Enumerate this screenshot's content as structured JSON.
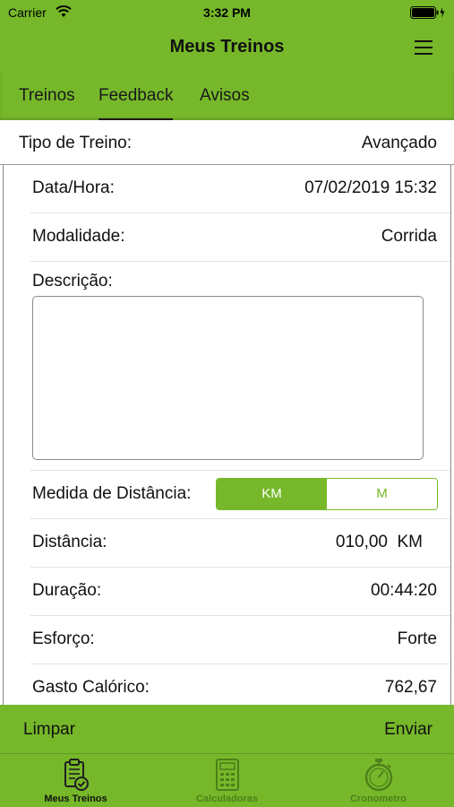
{
  "status_bar": {
    "carrier": "Carrier",
    "time": "3:32 PM",
    "wifi_icon": "wifi-icon",
    "battery_icon": "battery-icon"
  },
  "nav": {
    "title": "Meus Treinos",
    "menu_icon": "hamburger-menu-icon"
  },
  "tabs": [
    {
      "label": "Treinos",
      "active": false
    },
    {
      "label": "Feedback",
      "active": true
    },
    {
      "label": "Avisos",
      "active": false
    }
  ],
  "form": {
    "tipo_label": "Tipo de Treino:",
    "tipo_value": "Avançado",
    "data_label": "Data/Hora:",
    "data_value": "07/02/2019 15:32",
    "modalidade_label": "Modalidade:",
    "modalidade_value": "Corrida",
    "descricao_label": "Descrição:",
    "descricao_value": "",
    "medida_label": "Medida de Distância:",
    "medida_options": [
      "KM",
      "M"
    ],
    "medida_selected": "KM",
    "distancia_label": "Distância:",
    "distancia_value": "010,00",
    "distancia_unit": "KM",
    "duracao_label": "Duração:",
    "duracao_value": "00:44:20",
    "esforco_label": "Esforço:",
    "esforco_value": "Forte",
    "gasto_label": "Gasto Calórico:",
    "gasto_value": "762,67"
  },
  "actions": {
    "limpar": "Limpar",
    "enviar": "Enviar"
  },
  "tab_bar": [
    {
      "label": "Meus Treinos",
      "icon": "clipboard-check-icon",
      "active": true
    },
    {
      "label": "Calculadoras",
      "icon": "calculator-icon",
      "active": false
    },
    {
      "label": "Cronometro",
      "icon": "stopwatch-icon",
      "active": false
    }
  ],
  "colors": {
    "brand_green": "#76b82a",
    "inactive_tab_text": "#4e7f19"
  }
}
